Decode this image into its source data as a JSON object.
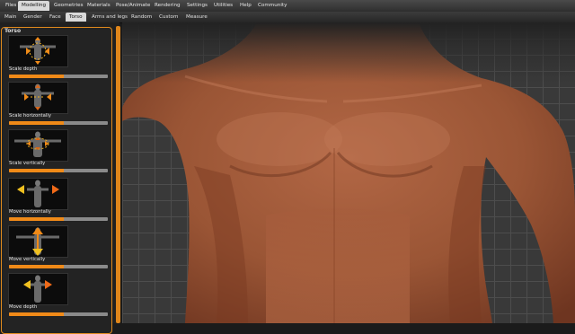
{
  "menu": {
    "tabs": [
      {
        "label": "Files"
      },
      {
        "label": "Modelling"
      },
      {
        "label": "Geometries"
      },
      {
        "label": "Materials"
      },
      {
        "label": "Pose/Animate"
      },
      {
        "label": "Rendering"
      },
      {
        "label": "Settings"
      },
      {
        "label": "Utilities"
      },
      {
        "label": "Help"
      },
      {
        "label": "Community"
      }
    ],
    "active": "Modelling"
  },
  "subtabs": {
    "tabs": [
      {
        "label": "Main"
      },
      {
        "label": "Gender"
      },
      {
        "label": "Face"
      },
      {
        "label": "Torso"
      },
      {
        "label": "Arms and legs"
      },
      {
        "label": "Random"
      },
      {
        "label": "Custom"
      },
      {
        "label": "Measure"
      }
    ],
    "active": "Torso"
  },
  "panel": {
    "title": "Torso",
    "sliders": [
      {
        "label": "Scale depth",
        "value": 0.55,
        "icon": "scale-depth-figure-icon"
      },
      {
        "label": "Scale horizontally",
        "value": 0.55,
        "icon": "scale-horizontal-figure-icon"
      },
      {
        "label": "Scale vertically",
        "value": 0.55,
        "icon": "scale-vertical-figure-icon"
      },
      {
        "label": "Move horizontally",
        "value": 0.55,
        "icon": "move-horizontal-figure-icon"
      },
      {
        "label": "Move vertically",
        "value": 0.55,
        "icon": "move-vertical-figure-icon"
      },
      {
        "label": "Move depth",
        "value": 0.55,
        "icon": "move-depth-figure-icon"
      }
    ]
  },
  "colors": {
    "accent": "#f08a18",
    "skin": "#9a5535",
    "grid_background": "#393939"
  }
}
